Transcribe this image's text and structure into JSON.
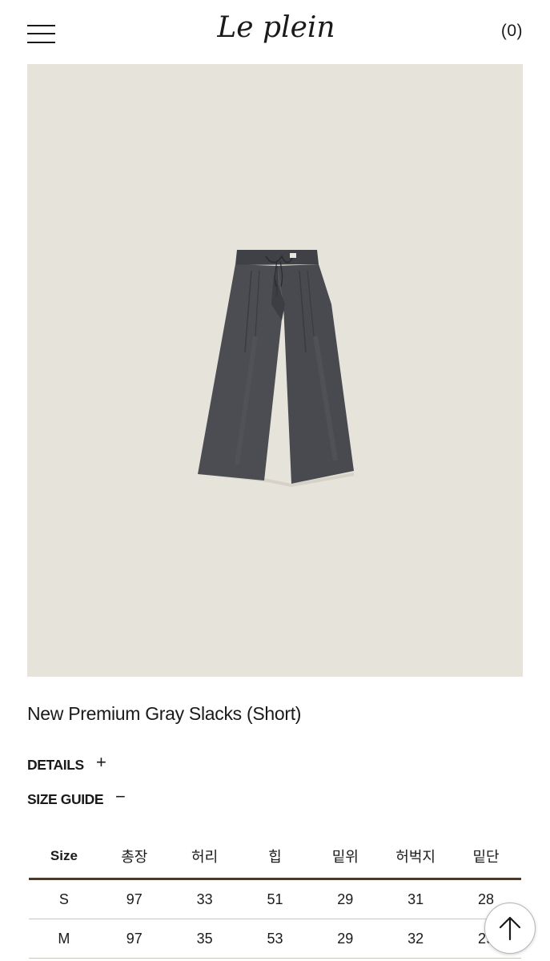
{
  "header": {
    "logo_text": "Le plein",
    "cart_label": "(0)"
  },
  "product": {
    "title": "New Premium Gray Slacks (Short)",
    "image_bg_color": "#e6e3da",
    "garment_color": "#4b4d52"
  },
  "accordions": {
    "details": {
      "label": "DETAILS",
      "toggle": "+"
    },
    "size_guide": {
      "label": "SIZE GUIDE",
      "toggle": "−"
    }
  },
  "size_table": {
    "headers": [
      "Size",
      "총장",
      "허리",
      "힙",
      "밑위",
      "허벅지",
      "밑단"
    ],
    "rows": [
      [
        "S",
        "97",
        "33",
        "51",
        "29",
        "31",
        "28"
      ],
      [
        "M",
        "97",
        "35",
        "53",
        "29",
        "32",
        "29"
      ]
    ]
  },
  "icons": {
    "menu": "hamburger-icon",
    "scroll_top": "arrow-up-icon"
  }
}
